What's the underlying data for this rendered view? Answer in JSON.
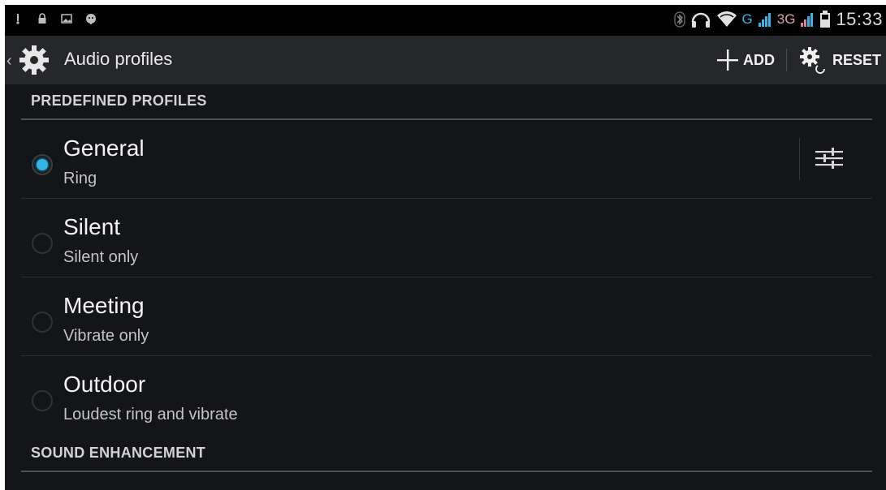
{
  "status_bar": {
    "time": "15:33",
    "network_g": "G",
    "network_3g": "3G",
    "icons": [
      "usb-debug-icon",
      "lock-icon",
      "gallery-icon",
      "android-icon",
      "bluetooth-icon",
      "headset-icon",
      "wifi-icon",
      "signal-icon",
      "battery-icon"
    ]
  },
  "action_bar": {
    "title": "Audio profiles",
    "add_label": "ADD",
    "reset_label": "RESET"
  },
  "sections": {
    "predefined": "PREDEFINED PROFILES",
    "enhancement": "SOUND ENHANCEMENT"
  },
  "profiles": [
    {
      "title": "General",
      "subtitle": "Ring",
      "selected": true
    },
    {
      "title": "Silent",
      "subtitle": "Silent only",
      "selected": false
    },
    {
      "title": "Meeting",
      "subtitle": "Vibrate only",
      "selected": false
    },
    {
      "title": "Outdoor",
      "subtitle": "Loudest ring and vibrate",
      "selected": false
    }
  ],
  "colors": {
    "accent": "#33b5e5",
    "background": "#141518",
    "action_bar": "#26272b"
  }
}
